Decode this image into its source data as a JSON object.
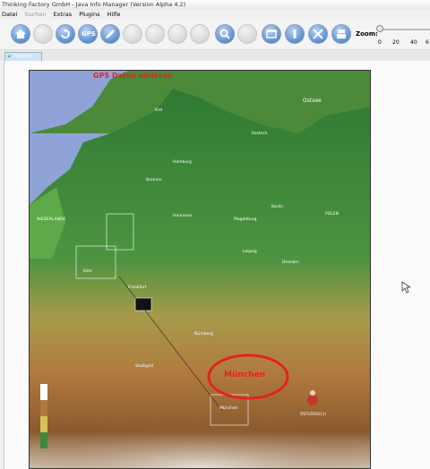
{
  "window": {
    "title": "Thinking Factory GmbH - Java Info Manager (Version Alpha 4.2)"
  },
  "menu": [
    {
      "label": "Datei",
      "enabled": true
    },
    {
      "label": "Suchen",
      "enabled": false
    },
    {
      "label": "Extras",
      "enabled": true
    },
    {
      "label": "Plugins",
      "enabled": true
    },
    {
      "label": "Hilfe",
      "enabled": true
    }
  ],
  "toolbar": {
    "buttons": [
      {
        "icon": "home-icon",
        "enabled": true
      },
      {
        "icon": "blank-icon",
        "enabled": false
      },
      {
        "icon": "refresh-icon",
        "enabled": true
      },
      {
        "icon": "gps-icon",
        "label": "GPS",
        "enabled": true
      },
      {
        "icon": "pencil-icon",
        "enabled": true
      },
      {
        "icon": "blank-icon",
        "enabled": false
      },
      {
        "icon": "blank-icon",
        "enabled": false
      },
      {
        "icon": "blank-icon",
        "enabled": false
      },
      {
        "icon": "blank-icon",
        "enabled": false
      },
      {
        "icon": "search-icon",
        "enabled": true
      },
      {
        "icon": "blank-icon",
        "enabled": false
      },
      {
        "icon": "window-icon",
        "enabled": true
      },
      {
        "icon": "info-icon",
        "enabled": true
      },
      {
        "icon": "tools-icon",
        "enabled": true
      },
      {
        "icon": "print-icon",
        "enabled": true
      }
    ],
    "zoom": {
      "label": "Zoom:",
      "value": 0,
      "ticks": [
        "0",
        "20",
        "40",
        "6"
      ]
    }
  },
  "tabs": [
    {
      "label": "Tabelle"
    }
  ],
  "annotations": {
    "gps_label": "GPS Daten einlesen",
    "munich_label": "München",
    "colors": {
      "annotation_red": "#e5221d",
      "sea": "#8fa3d9",
      "land_green": "#3f8a3a",
      "highland_brown": "#a57a46"
    }
  },
  "map": {
    "water_labels": [
      "Ostsee",
      "Nordsee"
    ],
    "country_labels": [
      "NIEDERLANDE",
      "POLEN",
      "ÖSTERREICH"
    ],
    "cities": [
      "Hamburg",
      "Berlin",
      "Bremen",
      "Hannover",
      "Magdeburg",
      "Dresden",
      "Leipzig",
      "Köln",
      "Frankfurt",
      "Nürnberg",
      "Stuttgart",
      "München",
      "Rostock",
      "Kiel"
    ]
  }
}
